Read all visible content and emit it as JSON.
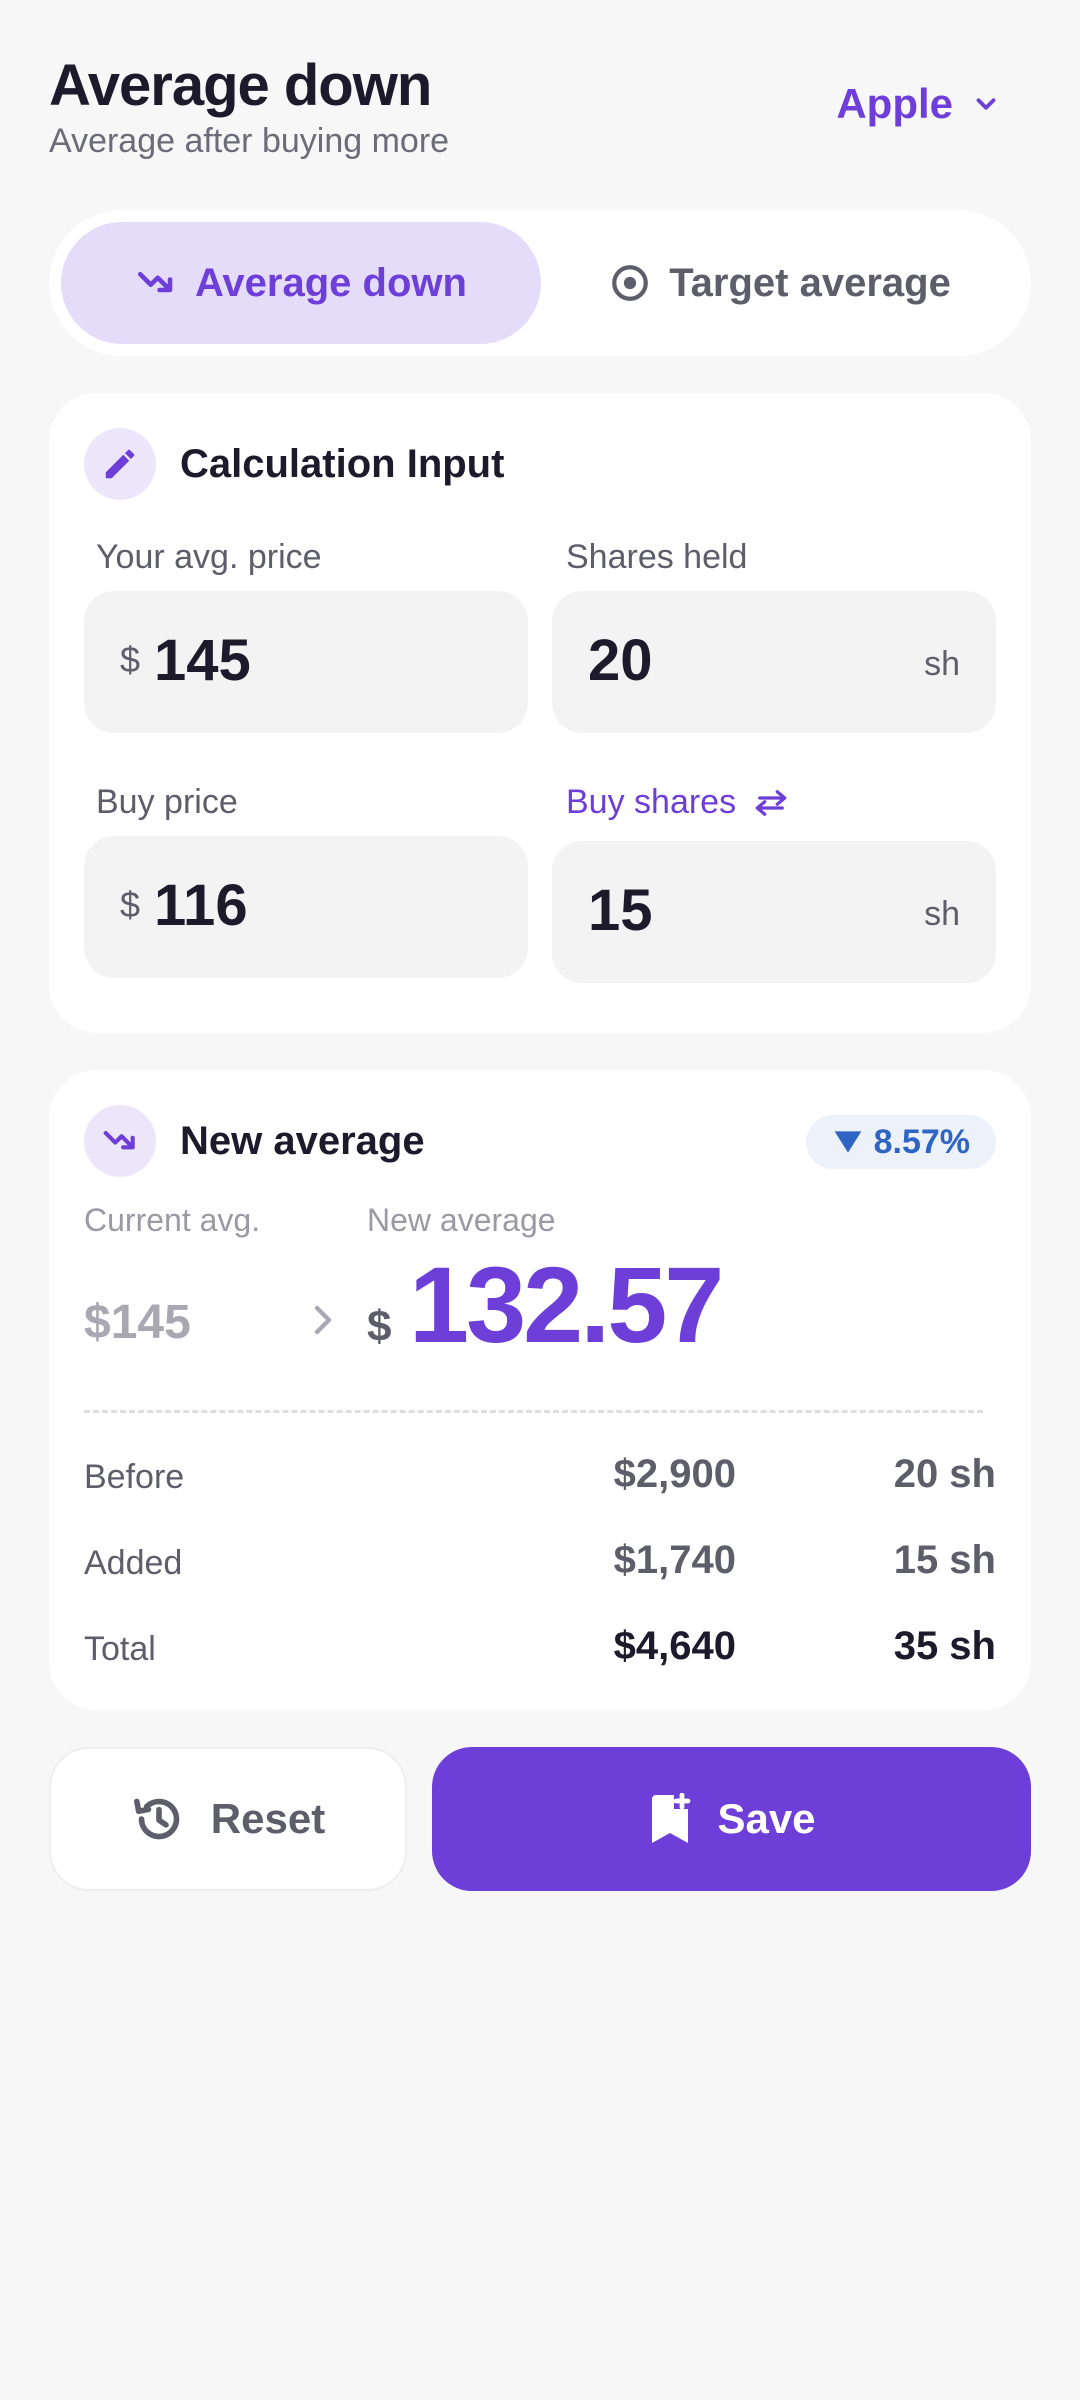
{
  "header": {
    "title": "Average down",
    "subtitle": "Average after buying more",
    "ticker": "Apple"
  },
  "modes": {
    "active": "Average down",
    "inactive": "Target average"
  },
  "input_card": {
    "title": "Calculation Input",
    "avg_price": {
      "label": "Your avg. price",
      "currency": "$",
      "value": "145"
    },
    "shares_held": {
      "label": "Shares held",
      "value": "20",
      "unit": "sh"
    },
    "buy_price": {
      "label": "Buy price",
      "currency": "$",
      "value": "116"
    },
    "buy_shares": {
      "label": "Buy shares",
      "value": "15",
      "unit": "sh"
    }
  },
  "result_card": {
    "title": "New average",
    "delta": "8.57%",
    "current_label": "Current avg.",
    "current_value": "$145",
    "new_label": "New average",
    "new_currency": "$",
    "new_value": "132.57",
    "rows": [
      {
        "label": "Before",
        "amount": "$2,900",
        "shares": "20 sh"
      },
      {
        "label": "Added",
        "amount": "$1,740",
        "shares": "15 sh"
      },
      {
        "label": "Total",
        "amount": "$4,640",
        "shares": "35 sh"
      }
    ]
  },
  "actions": {
    "reset": "Reset",
    "save": "Save"
  },
  "colors": {
    "accent": "#6d3fd8",
    "accent_soft": "#e5dcfa",
    "badge_text": "#2e64c4",
    "background": "#f7f7f8"
  }
}
